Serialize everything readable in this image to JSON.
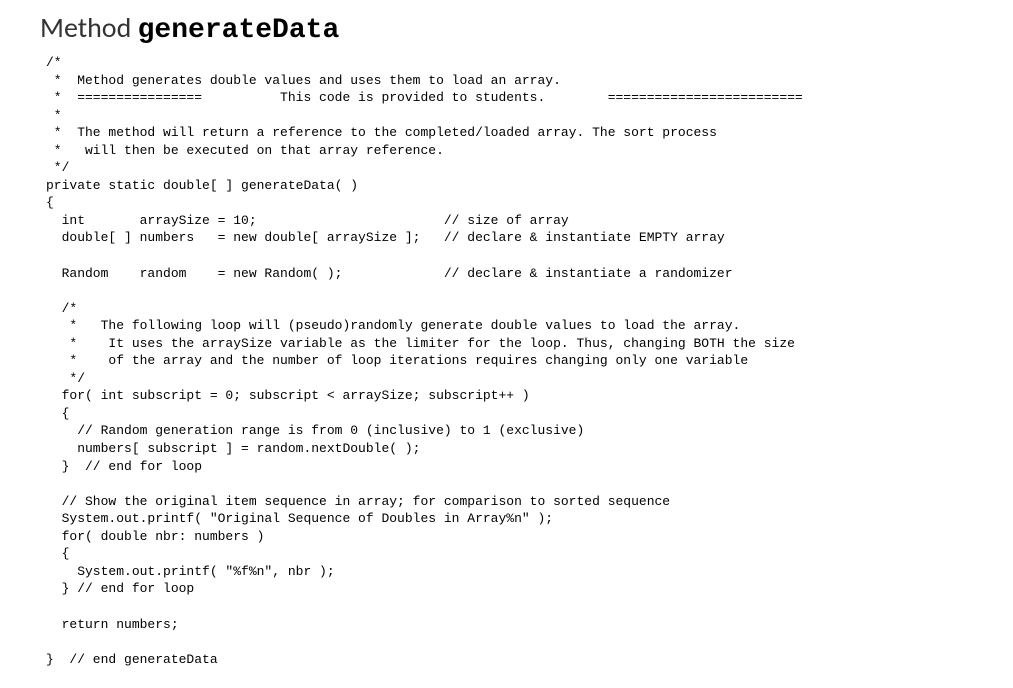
{
  "title": {
    "prefix": "Method ",
    "name": "generateData"
  },
  "code": "/*\n *  Method generates double values and uses them to load an array.\n *  ================          This code is provided to students.        =========================\n *\n *  The method will return a reference to the completed/loaded array. The sort process\n *   will then be executed on that array reference.\n */\nprivate static double[ ] generateData( )\n{\n  int       arraySize = 10;                        // size of array\n  double[ ] numbers   = new double[ arraySize ];   // declare & instantiate EMPTY array\n\n  Random    random    = new Random( );             // declare & instantiate a randomizer\n\n  /*\n   *   The following loop will (pseudo)randomly generate double values to load the array.\n   *    It uses the arraySize variable as the limiter for the loop. Thus, changing BOTH the size\n   *    of the array and the number of loop iterations requires changing only one variable\n   */\n  for( int subscript = 0; subscript < arraySize; subscript++ )\n  {\n    // Random generation range is from 0 (inclusive) to 1 (exclusive)\n    numbers[ subscript ] = random.nextDouble( );\n  }  // end for loop\n\n  // Show the original item sequence in array; for comparison to sorted sequence\n  System.out.printf( \"Original Sequence of Doubles in Array%n\" );\n  for( double nbr: numbers )\n  {\n    System.out.printf( \"%f%n\", nbr );\n  } // end for loop\n\n  return numbers;\n\n}  // end generateData"
}
